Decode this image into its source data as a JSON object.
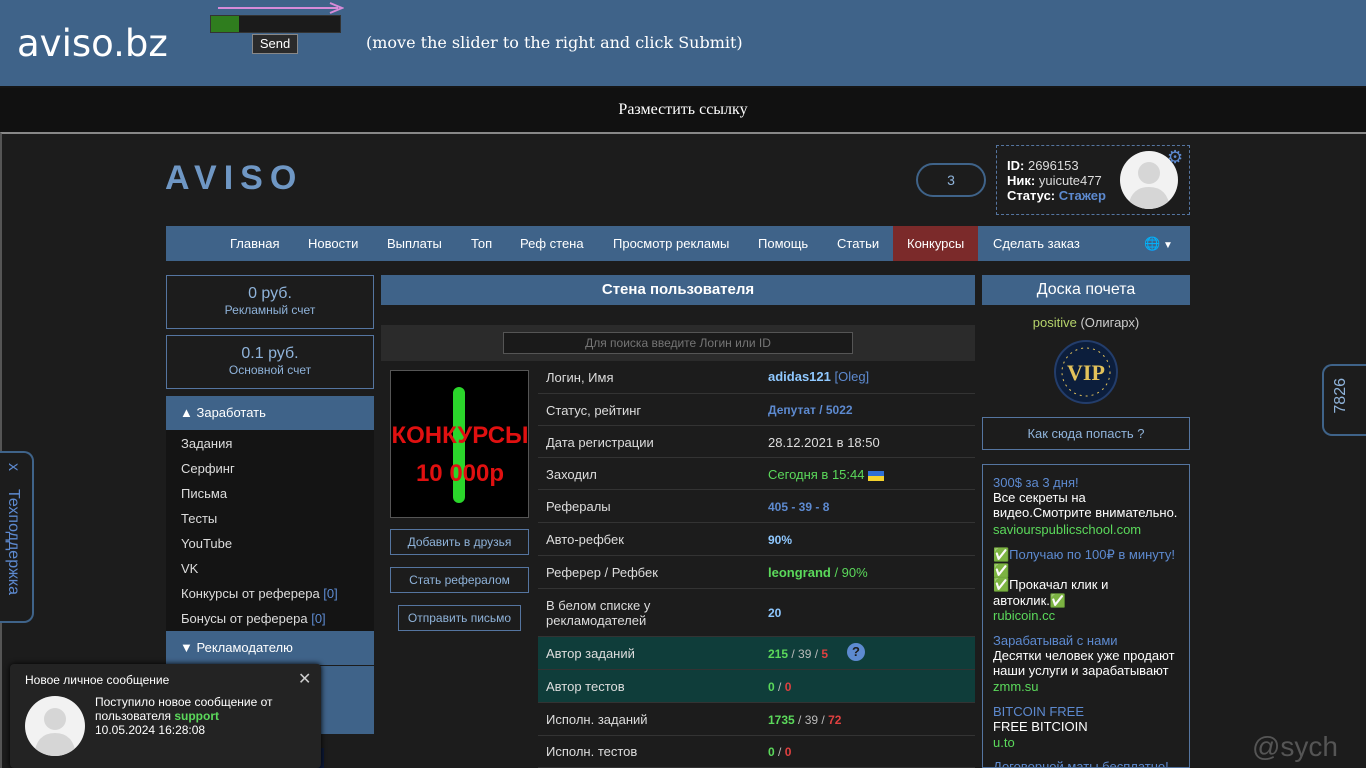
{
  "topbar": {
    "logo": "aviso.bz",
    "slider_progress": 0.22,
    "send_label": "Send",
    "hint": "(move the slider to the right and click Submit)"
  },
  "placebar": {
    "label": "Разместить ссылку"
  },
  "header": {
    "brand": "AVISO",
    "notif_count": "3",
    "profile": {
      "id_label": "ID:",
      "id_value": "2696153",
      "nick_label": "Ник:",
      "nick_value": "yuicute477",
      "status_label": "Статус:",
      "status_value": "Стажер"
    }
  },
  "nav": {
    "items": [
      "Главная",
      "Новости",
      "Выплаты",
      "Топ",
      "Реф стена",
      "Просмотр рекламы",
      "Помощь",
      "Статьи",
      "Конкурсы",
      "Сделать заказ"
    ],
    "active": "Конкурсы"
  },
  "accounts": {
    "ad_amount": "0 руб.",
    "ad_label": "Рекламный счет",
    "main_amount": "0.1 руб.",
    "main_label": "Основной счет"
  },
  "earn_menu": {
    "header": "Заработать",
    "items": [
      "Задания",
      "Серфинг",
      "Письма",
      "Тесты",
      "YouTube",
      "VK",
      "Конкурсы от реферера",
      "Бонусы от реферера"
    ],
    "counts": {
      "contests": "[0]",
      "bonuses": "[0]"
    },
    "advertiser_header": "Рекламодателю"
  },
  "wall": {
    "title": "Стена пользователя",
    "search_placeholder": "Для поиска введите Логин или ID",
    "promo_line1": "КОНКУРСЫ",
    "promo_line2": "10 000р",
    "btn_add_friend": "Добавить в друзья",
    "btn_referral": "Стать рефералом",
    "btn_send_mail": "Отправить письмо",
    "rows": [
      {
        "k": "Логин, Имя",
        "v1": "adidas121",
        "v2": " [Oleg]"
      },
      {
        "k": "Статус, рейтинг",
        "v1": "Депутат / 5022"
      },
      {
        "k": "Дата регистрации",
        "v1": "28.12.2021 в 18:50"
      },
      {
        "k": "Заходил",
        "v1": "Сегодня в 15:44"
      },
      {
        "k": "Рефералы",
        "v1": "405 - 39 - 8"
      },
      {
        "k": "Авто-рефбек",
        "v1": "90%"
      },
      {
        "k": "Реферер / Рефбек",
        "v1": "leongrand",
        "v2": " / 90%"
      },
      {
        "k": "В белом списке у рекламодателей",
        "v1": "20"
      },
      {
        "k": "Автор заданий",
        "v1": "215",
        "v2": " / 39 / ",
        "v3": "5"
      },
      {
        "k": "Автор тестов",
        "v1": "0",
        "v2": " / ",
        "v3": "0"
      },
      {
        "k": "Исполн. заданий",
        "v1": "1735",
        "v2": " / 39 / ",
        "v3": "72"
      },
      {
        "k": "Исполн. тестов",
        "v1": "0",
        "v2": " / ",
        "v3": "0"
      }
    ]
  },
  "honor": {
    "title": "Доска почета",
    "user": "positive",
    "rank": "(Олигарх)",
    "how_to": "Как сюда попасть ?"
  },
  "ads": {
    "a1_title": "300$ за 3 дня!",
    "a1_text": "Все секреты на видео.Смотрите внимательно.",
    "a1_url": "saviourspublicschool.com",
    "a2_title": "✅Получаю по 100₽ в минуту!✅",
    "a2_text": "✅Прокачал клик и автоклик.✅",
    "a2_url": "rubicoin.cc",
    "a3_title": "Зарабатывай с нами",
    "a3_text": "Десятки человек уже продают наши услуги и зарабатывают",
    "a3_url": "zmm.su",
    "a4_title": "BITCOIN FREE",
    "a4_text": "FREE BITCIOIN",
    "a4_url": "u.to",
    "a5_title": "Договорной маты бесплатно!"
  },
  "side_tab": {
    "close": "x",
    "label": "Техподдержка"
  },
  "counter_tab": {
    "value": "7826"
  },
  "toast": {
    "title": "Новое личное сообщение",
    "msg1": "Поступило новое сообщение от пользователя ",
    "sender": "support",
    "time": "10.05.2024 16:28:08"
  },
  "watermark": "@sych",
  "colors": {
    "accent": "#3f6389",
    "green": "#5bd95b",
    "red": "#e04040",
    "link": "#5d8ad0"
  }
}
